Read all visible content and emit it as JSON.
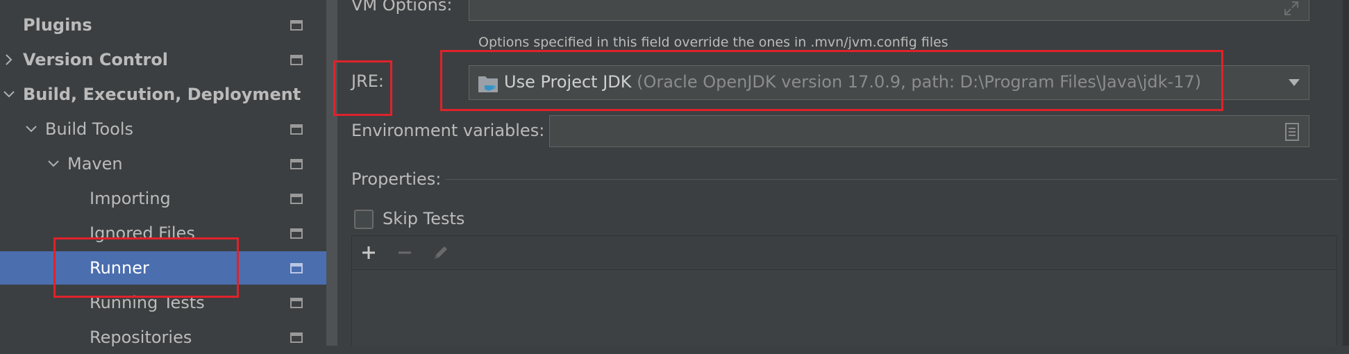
{
  "sidebar": {
    "items": [
      {
        "label": "Plugins",
        "bold": true,
        "indent": 0,
        "arrow": "none",
        "selected": false
      },
      {
        "label": "Version Control",
        "bold": true,
        "indent": 0,
        "arrow": "right",
        "selected": false
      },
      {
        "label": "Build, Execution, Deployment",
        "bold": true,
        "indent": 0,
        "arrow": "down",
        "selected": false
      },
      {
        "label": "Build Tools",
        "bold": false,
        "indent": 1,
        "arrow": "down",
        "selected": false
      },
      {
        "label": "Maven",
        "bold": false,
        "indent": 2,
        "arrow": "down",
        "selected": false
      },
      {
        "label": "Importing",
        "bold": false,
        "indent": 3,
        "arrow": "none",
        "selected": false
      },
      {
        "label": "Ignored Files",
        "bold": false,
        "indent": 3,
        "arrow": "none",
        "selected": false
      },
      {
        "label": "Runner",
        "bold": false,
        "indent": 3,
        "arrow": "none",
        "selected": true
      },
      {
        "label": "Running Tests",
        "bold": false,
        "indent": 3,
        "arrow": "none",
        "selected": false
      },
      {
        "label": "Repositories",
        "bold": false,
        "indent": 3,
        "arrow": "none",
        "selected": false
      }
    ]
  },
  "form": {
    "vm_options_label": "VM Options:",
    "vm_options_value": "",
    "vm_options_hint": "Options specified in this field override the ones in .mvn/jvm.config files",
    "jre_label": "JRE:",
    "jre_value_main": "Use Project JDK",
    "jre_value_sub": "(Oracle OpenJDK version 17.0.9, path: D:\\Program Files\\Java\\jdk-17)",
    "env_label": "Environment variables:",
    "env_value": "",
    "properties_label": "Properties:",
    "skip_tests_label": "Skip Tests",
    "skip_tests_checked": false
  },
  "toolbar_icons": [
    "add-icon",
    "remove-icon",
    "edit-icon"
  ],
  "colors": {
    "selection": "#4b6eaf",
    "highlight_box": "#e0222a",
    "background": "#3c3f41"
  }
}
